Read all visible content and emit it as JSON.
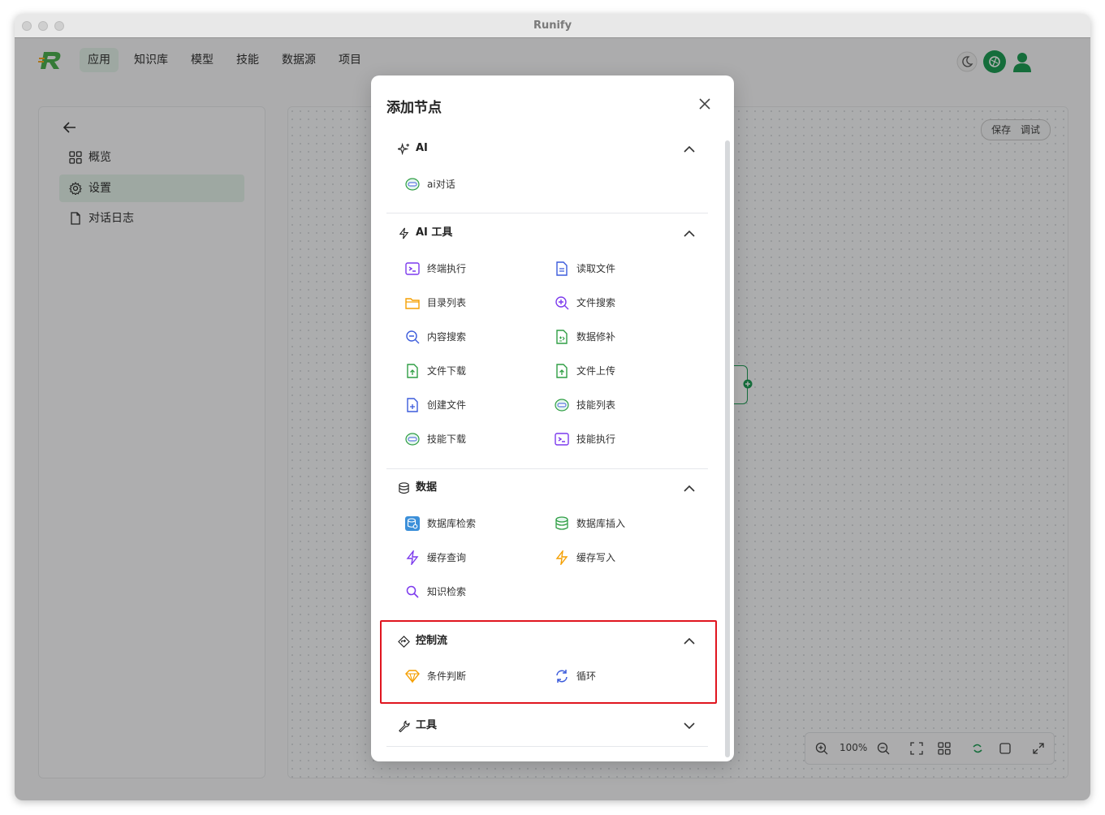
{
  "window": {
    "title": "Runify"
  },
  "nav": {
    "items": [
      {
        "label": "应用",
        "active": true
      },
      {
        "label": "知识库"
      },
      {
        "label": "模型"
      },
      {
        "label": "技能"
      },
      {
        "label": "数据源"
      },
      {
        "label": "项目"
      }
    ],
    "right_icons": [
      "moon-icon",
      "brand-badge-icon",
      "user-avatar-icon"
    ]
  },
  "sidebar": {
    "items": [
      {
        "label": "概览",
        "icon": "grid-icon"
      },
      {
        "label": "设置",
        "icon": "gear-icon",
        "active": true
      },
      {
        "label": "对话日志",
        "icon": "file-icon"
      }
    ]
  },
  "canvas": {
    "save_label": "保存",
    "debug_label": "调试",
    "zoom_level": "100%"
  },
  "modal": {
    "title": "添加节点",
    "sections": [
      {
        "title": "AI",
        "icon": "sparkle-icon",
        "expanded": true,
        "items": [
          {
            "label": "ai对话",
            "icon": "chat-bubble-icon"
          }
        ]
      },
      {
        "title": "AI 工具",
        "icon": "lightning-icon",
        "expanded": true,
        "items": [
          {
            "label": "终端执行",
            "icon": "terminal-icon"
          },
          {
            "label": "读取文件",
            "icon": "file-text-icon"
          },
          {
            "label": "目录列表",
            "icon": "folder-icon"
          },
          {
            "label": "文件搜索",
            "icon": "search-plus-icon"
          },
          {
            "label": "内容搜索",
            "icon": "search-minus-icon"
          },
          {
            "label": "数据修补",
            "icon": "file-diff-icon"
          },
          {
            "label": "文件下载",
            "icon": "file-download-icon"
          },
          {
            "label": "文件上传",
            "icon": "file-upload-icon"
          },
          {
            "label": "创建文件",
            "icon": "file-plus-icon"
          },
          {
            "label": "技能列表",
            "icon": "chat-bubble-icon"
          },
          {
            "label": "技能下载",
            "icon": "chat-bubble-icon"
          },
          {
            "label": "技能执行",
            "icon": "terminal-icon"
          }
        ]
      },
      {
        "title": "数据",
        "icon": "database-icon",
        "expanded": true,
        "items": [
          {
            "label": "数据库检索",
            "icon": "database-search-icon"
          },
          {
            "label": "数据库插入",
            "icon": "database-insert-icon"
          },
          {
            "label": "缓存查询",
            "icon": "lightning-purple-icon"
          },
          {
            "label": "缓存写入",
            "icon": "lightning-orange-icon"
          },
          {
            "label": "知识检索",
            "icon": "search-icon"
          }
        ]
      },
      {
        "title": "控制流",
        "icon": "diamond-route-icon",
        "expanded": true,
        "items": [
          {
            "label": "条件判断",
            "icon": "diamond-icon"
          },
          {
            "label": "循环",
            "icon": "loop-icon"
          }
        ]
      },
      {
        "title": "工具",
        "icon": "wrench-icon",
        "expanded": false,
        "items": []
      }
    ]
  },
  "colors": {
    "accent_green": "#1f9d55",
    "highlight_red": "#e0151f",
    "purple": "#7c3aed",
    "blue": "#3b5bdb",
    "orange": "#f59f00",
    "green": "#2f9e44"
  }
}
